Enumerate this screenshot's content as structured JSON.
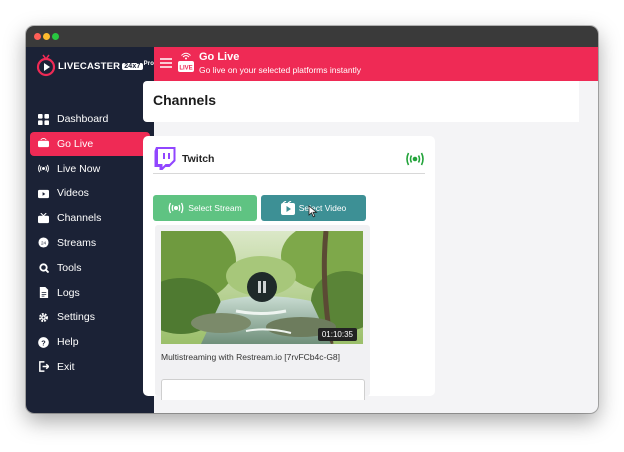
{
  "app": {
    "logo_text": "LIVECASTER",
    "logo_badge": "24x7",
    "logo_suffix": "Pro"
  },
  "sidebar": {
    "items": [
      {
        "label": "Dashboard",
        "icon": "dashboard-icon",
        "active": false
      },
      {
        "label": "Go Live",
        "icon": "live-badge-icon",
        "active": true
      },
      {
        "label": "Live Now",
        "icon": "broadcast-icon",
        "active": false
      },
      {
        "label": "Videos",
        "icon": "video-icon",
        "active": false
      },
      {
        "label": "Channels",
        "icon": "tv-icon",
        "active": false
      },
      {
        "label": "Streams",
        "icon": "streams-icon",
        "active": false
      },
      {
        "label": "Tools",
        "icon": "tools-icon",
        "active": false
      },
      {
        "label": "Logs",
        "icon": "logs-icon",
        "active": false
      },
      {
        "label": "Settings",
        "icon": "gear-icon",
        "active": false
      },
      {
        "label": "Help",
        "icon": "help-icon",
        "active": false
      },
      {
        "label": "Exit",
        "icon": "exit-icon",
        "active": false
      }
    ]
  },
  "header": {
    "title": "Go Live",
    "subtitle": "Go live on your selected platforms instantly",
    "live_badge": "LIVE"
  },
  "main": {
    "section_title": "Channels",
    "channel": {
      "name": "Twitch",
      "select_stream_label": "Select Stream",
      "select_video_label": "Select Video",
      "video": {
        "title": "Multistreaming with Restream.io [7rvFCb4c-G8]",
        "duration": "01:10:35"
      }
    }
  },
  "colors": {
    "accent": "#ef2a55",
    "sidebar_bg": "#1b2236",
    "twitch": "#9146ff",
    "live_green": "#22a33a",
    "stream_button": "#5fc382",
    "video_button": "#3d9095"
  }
}
